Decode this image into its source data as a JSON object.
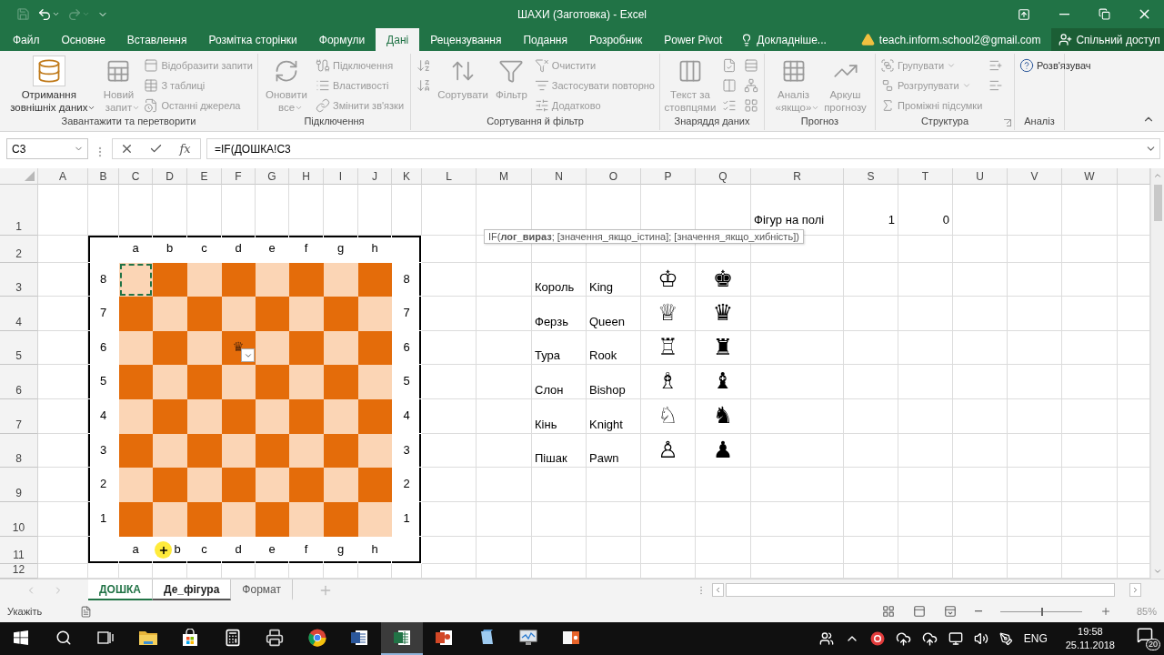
{
  "window": {
    "title": "ШАХИ (Заготовка) - Excel"
  },
  "tabs": [
    {
      "label": "Файл",
      "selected": false
    },
    {
      "label": "Основне",
      "selected": false
    },
    {
      "label": "Вставлення",
      "selected": false
    },
    {
      "label": "Розмітка сторінки",
      "selected": false
    },
    {
      "label": "Формули",
      "selected": false
    },
    {
      "label": "Дані",
      "selected": true
    },
    {
      "label": "Рецензування",
      "selected": false
    },
    {
      "label": "Подання",
      "selected": false
    },
    {
      "label": "Розробник",
      "selected": false
    },
    {
      "label": "Power Pivot",
      "selected": false
    }
  ],
  "tell_me": "Докладніше...",
  "account": "teach.inform.school2@gmail.com",
  "share_button": "Спільний доступ",
  "ribbon": {
    "groups": [
      {
        "label": "Завантажити та перетворити",
        "items": [
          {
            "kind": "large",
            "label": "Отримання зовнішніх даних",
            "dropdown": true,
            "disabled": false
          },
          {
            "kind": "large",
            "label": "Новий запит",
            "dropdown": true,
            "disabled": true
          },
          {
            "kind": "stack",
            "items": [
              {
                "label": "Відобразити запити",
                "disabled": true
              },
              {
                "label": "З таблиці",
                "disabled": true
              },
              {
                "label": "Останні джерела",
                "disabled": true
              }
            ]
          }
        ]
      },
      {
        "label": "Підключення",
        "items": [
          {
            "kind": "large",
            "label": "Оновити все",
            "dropdown": true,
            "disabled": true
          },
          {
            "kind": "stack",
            "items": [
              {
                "label": "Підключення",
                "disabled": true
              },
              {
                "label": "Властивості",
                "disabled": true
              },
              {
                "label": "Змінити зв'язки",
                "disabled": true
              }
            ]
          }
        ]
      },
      {
        "label": "Сортування й фільтр",
        "items": [
          {
            "kind": "icons",
            "items": [
              {
                "disabled": true
              },
              {
                "disabled": true
              }
            ]
          },
          {
            "kind": "large",
            "label": "Сортувати",
            "dropdown": false,
            "disabled": true
          },
          {
            "kind": "large",
            "label": "Фільтр",
            "dropdown": false,
            "disabled": true
          },
          {
            "kind": "stack",
            "items": [
              {
                "label": "Очистити",
                "disabled": true
              },
              {
                "label": "Застосувати повторно",
                "disabled": true
              },
              {
                "label": "Додатково",
                "disabled": true
              }
            ]
          }
        ]
      },
      {
        "label": "Знаряддя даних",
        "items": [
          {
            "kind": "large",
            "label": "Текст за стовпцями",
            "disabled": true
          },
          {
            "kind": "icons",
            "items": [
              {
                "disabled": true
              },
              {
                "disabled": true
              },
              {
                "disabled": true
              }
            ]
          },
          {
            "kind": "icons",
            "items": [
              {
                "disabled": true
              },
              {
                "disabled": true
              },
              {
                "disabled": true
              }
            ]
          }
        ]
      },
      {
        "label": "Прогноз",
        "items": [
          {
            "kind": "large",
            "label": "Аналіз «якщо»",
            "dropdown": true,
            "disabled": true
          },
          {
            "kind": "large",
            "label": "Аркуш прогнозу",
            "dropdown": false,
            "disabled": true
          }
        ]
      },
      {
        "label": "Структура",
        "launcher": true,
        "items": [
          {
            "kind": "stack",
            "items": [
              {
                "label": "Групувати",
                "dropdown": true,
                "disabled": true
              },
              {
                "label": "Розгрупувати",
                "dropdown": true,
                "disabled": true
              },
              {
                "label": "Проміжні підсумки",
                "dropdown": false,
                "disabled": true
              }
            ]
          },
          {
            "kind": "icons",
            "items": [
              {
                "disabled": true
              },
              {
                "disabled": true
              }
            ]
          }
        ]
      },
      {
        "label": "Аналіз",
        "items": [
          {
            "kind": "stack",
            "items": [
              {
                "label": "Розв'язувач",
                "dropdown": false,
                "disabled": false
              }
            ]
          }
        ]
      }
    ]
  },
  "formula_bar": {
    "name_box": "C3",
    "insert_function": "fx",
    "formula": "=IF(ДОШКА!C3",
    "tooltip": "IF(**лог_вираз**; [значення_якщо_істина]; [значення_якщо_хибність])"
  },
  "columns": [
    "A",
    "B",
    "C",
    "D",
    "E",
    "F",
    "G",
    "H",
    "I",
    "J",
    "K",
    "L",
    "M",
    "N",
    "O",
    "P",
    "Q",
    "R",
    "S",
    "T",
    "U",
    "V",
    "W"
  ],
  "rows": [
    "1",
    "2",
    "3",
    "4",
    "5",
    "6",
    "7",
    "8",
    "9",
    "10",
    "11",
    "12"
  ],
  "counter": {
    "label": "Фігур на полі",
    "values": [
      "1",
      "0"
    ]
  },
  "board": {
    "top_files": [
      "a",
      "b",
      "c",
      "d",
      "e",
      "f",
      "g",
      "h"
    ],
    "bottom_files": [
      "a",
      "b",
      "c",
      "d",
      "e",
      "f",
      "g",
      "h"
    ],
    "left_ranks": [
      "8",
      "7",
      "6",
      "5",
      "4",
      "3",
      "2",
      "1"
    ],
    "right_ranks": [
      "8",
      "7",
      "6",
      "5",
      "4",
      "3",
      "2",
      "1"
    ],
    "squares": [
      [
        {
          "color": "#fbd5b5",
          "selected": true
        },
        {
          "color": "#e46c0a",
          "selected": false
        },
        {
          "color": "#fbd5b5",
          "selected": false
        },
        {
          "color": "#e46c0a",
          "selected": false
        },
        {
          "color": "#fbd5b5",
          "selected": false
        },
        {
          "color": "#e46c0a",
          "selected": false
        },
        {
          "color": "#fbd5b5",
          "selected": false
        },
        {
          "color": "#e46c0a",
          "selected": false
        }
      ],
      [
        {
          "color": "#e46c0a",
          "selected": false
        },
        {
          "color": "#fbd5b5",
          "selected": false
        },
        {
          "color": "#e46c0a",
          "selected": false
        },
        {
          "color": "#fbd5b5",
          "selected": false
        },
        {
          "color": "#e46c0a",
          "selected": false
        },
        {
          "color": "#fbd5b5",
          "selected": false
        },
        {
          "color": "#e46c0a",
          "selected": false
        },
        {
          "color": "#fbd5b5",
          "selected": false
        }
      ],
      [
        {
          "color": "#fbd5b5",
          "selected": false
        },
        {
          "color": "#e46c0a",
          "selected": false
        },
        {
          "color": "#fbd5b5",
          "selected": false
        },
        {
          "color": "#e46c0a",
          "selected": false,
          "piece": "♛",
          "dropdown": true
        },
        {
          "color": "#fbd5b5",
          "selected": false
        },
        {
          "color": "#e46c0a",
          "selected": false
        },
        {
          "color": "#fbd5b5",
          "selected": false
        },
        {
          "color": "#e46c0a",
          "selected": false
        }
      ],
      [
        {
          "color": "#e46c0a",
          "selected": false
        },
        {
          "color": "#fbd5b5",
          "selected": false
        },
        {
          "color": "#e46c0a",
          "selected": false
        },
        {
          "color": "#fbd5b5",
          "selected": false
        },
        {
          "color": "#e46c0a",
          "selected": false
        },
        {
          "color": "#fbd5b5",
          "selected": false
        },
        {
          "color": "#e46c0a",
          "selected": false
        },
        {
          "color": "#fbd5b5",
          "selected": false
        }
      ],
      [
        {
          "color": "#fbd5b5",
          "selected": false
        },
        {
          "color": "#e46c0a",
          "selected": false
        },
        {
          "color": "#fbd5b5",
          "selected": false
        },
        {
          "color": "#e46c0a",
          "selected": false
        },
        {
          "color": "#fbd5b5",
          "selected": false
        },
        {
          "color": "#e46c0a",
          "selected": false
        },
        {
          "color": "#fbd5b5",
          "selected": false
        },
        {
          "color": "#e46c0a",
          "selected": false
        }
      ],
      [
        {
          "color": "#e46c0a",
          "selected": false
        },
        {
          "color": "#fbd5b5",
          "selected": false
        },
        {
          "color": "#e46c0a",
          "selected": false
        },
        {
          "color": "#fbd5b5",
          "selected": false
        },
        {
          "color": "#e46c0a",
          "selected": false
        },
        {
          "color": "#fbd5b5",
          "selected": false
        },
        {
          "color": "#e46c0a",
          "selected": false
        },
        {
          "color": "#fbd5b5",
          "selected": false
        }
      ],
      [
        {
          "color": "#fbd5b5",
          "selected": false
        },
        {
          "color": "#e46c0a",
          "selected": false
        },
        {
          "color": "#fbd5b5",
          "selected": false
        },
        {
          "color": "#e46c0a",
          "selected": false
        },
        {
          "color": "#fbd5b5",
          "selected": false
        },
        {
          "color": "#e46c0a",
          "selected": false
        },
        {
          "color": "#fbd5b5",
          "selected": false
        },
        {
          "color": "#e46c0a",
          "selected": false
        }
      ],
      [
        {
          "color": "#e46c0a",
          "selected": false
        },
        {
          "color": "#fbd5b5",
          "selected": false
        },
        {
          "color": "#e46c0a",
          "selected": false
        },
        {
          "color": "#fbd5b5",
          "selected": false
        },
        {
          "color": "#e46c0a",
          "selected": false
        },
        {
          "color": "#fbd5b5",
          "selected": false
        },
        {
          "color": "#e46c0a",
          "selected": false
        },
        {
          "color": "#fbd5b5",
          "selected": false
        }
      ]
    ]
  },
  "legend": [
    {
      "name": "Король",
      "english": "King",
      "white": "♔",
      "black": "♚"
    },
    {
      "name": "Ферзь",
      "english": "Queen",
      "white": "♕",
      "black": "♛"
    },
    {
      "name": "Тура",
      "english": "Rook",
      "white": "♖",
      "black": "♜"
    },
    {
      "name": "Слон",
      "english": "Bishop",
      "white": "♗",
      "black": "♝"
    },
    {
      "name": "Кінь",
      "english": "Knight",
      "white": "♘",
      "black": "♞"
    },
    {
      "name": "Пішак",
      "english": "Pawn",
      "white": "♙",
      "black": "♟"
    }
  ],
  "sheet_tabs": [
    {
      "label": "ДОШКА",
      "selected": true,
      "grouped": true
    },
    {
      "label": "Де_фігура",
      "selected": false,
      "grouped": true
    },
    {
      "label": "Формат",
      "selected": false,
      "grouped": false
    }
  ],
  "status_bar": {
    "mode": "Укажіть",
    "zoom_slider": {
      "level": 0.5
    },
    "zoom": "85%"
  },
  "taskbar": {
    "items": [
      {
        "kind": "start",
        "selected": false
      },
      {
        "kind": "search",
        "selected": false
      },
      {
        "kind": "taskview",
        "selected": false
      },
      {
        "kind": "explorer",
        "selected": false
      },
      {
        "kind": "store",
        "selected": false
      },
      {
        "kind": "calculator",
        "selected": false
      },
      {
        "kind": "printer",
        "selected": false
      },
      {
        "kind": "chrome",
        "selected": false
      },
      {
        "kind": "word",
        "selected": false
      },
      {
        "kind": "excel",
        "selected": true
      },
      {
        "kind": "powerpoint",
        "selected": false
      },
      {
        "kind": "notepad",
        "selected": false
      },
      {
        "kind": "monitor",
        "selected": false
      },
      {
        "kind": "app",
        "selected": false
      }
    ],
    "language": "ENG",
    "time": "19:58",
    "date": "25.11.2018",
    "notifications": "20"
  }
}
